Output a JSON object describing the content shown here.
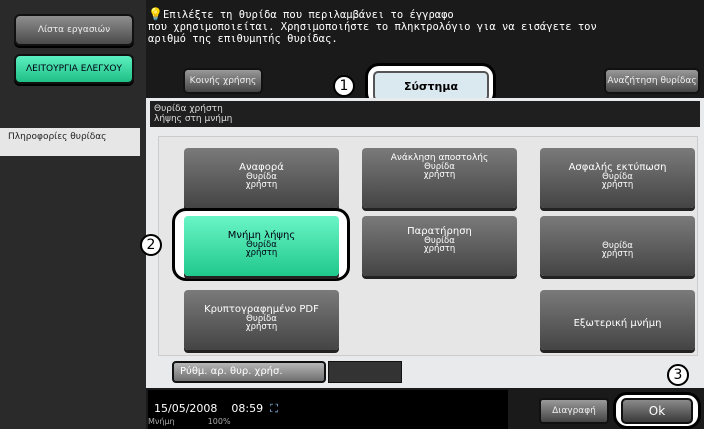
{
  "left": {
    "jobs_button": "Λίστα εργασιών",
    "utility_button": "ΛΕΙΤΟΥΡΓΙΑ ΕΛΕΓΧΟΥ",
    "info_tab": "Πληροφορίες θυρίδας"
  },
  "message": {
    "line1": "Επιλέξτε τη θυρίδα που περιλαμβάνει το έγγραφο",
    "line2": "που χρησιμοποιείται. Χρησιμοποιήστε το πληκτρολόγιο για να εισάγετε τον",
    "line3": "αριθμό της επιθυμητής θυρίδας."
  },
  "tabs": {
    "public": "Κοινής χρήσης",
    "system": "Σύστημα",
    "search": "Αναζήτηση θυρίδας"
  },
  "panel": {
    "title_line1": "Θυρίδα χρήστη",
    "title_line2": "λήψης στη μνήμη"
  },
  "boxes": [
    {
      "title": "Αναφορά",
      "sub1": "Θυρίδα",
      "sub2": "χρήστη"
    },
    {
      "title": "Ανάκληση αποστολής",
      "sub1": "Θυρίδα",
      "sub2": "χρήστη"
    },
    {
      "title": "Ασφαλής εκτύπωση",
      "sub1": "Θυρίδα",
      "sub2": "χρήστη"
    },
    {
      "title": "Μνήμη λήψης",
      "sub1": "Θυρίδα",
      "sub2": "χρήστη"
    },
    {
      "title": "Παρατήρηση",
      "sub1": "Θυρίδα",
      "sub2": "χρήστη"
    },
    {
      "title": "",
      "sub1": "Θυρίδα",
      "sub2": "χρήστη"
    },
    {
      "title": "Κρυπτογραφημένο PDF",
      "sub1": "Θυρίδα",
      "sub2": "χρήστη"
    },
    {
      "title": "Εξωτερική μνήμη",
      "sub1": "",
      "sub2": ""
    }
  ],
  "bottom": {
    "settings_button": "Ρύθμ. αρ. θυρ. χρήσ.",
    "delete_button": "Διαγραφή",
    "ok_button": "Ok"
  },
  "status": {
    "date": "15/05/2008",
    "time": "08:59",
    "memory_label": "Μνήμη",
    "memory_value": "100%"
  },
  "callouts": {
    "one": "1",
    "two": "2",
    "three": "3"
  },
  "colors": {
    "accent_green": "#2bd69a",
    "tab_selected": "#d9e9ef",
    "background": "#1a1a1a"
  }
}
